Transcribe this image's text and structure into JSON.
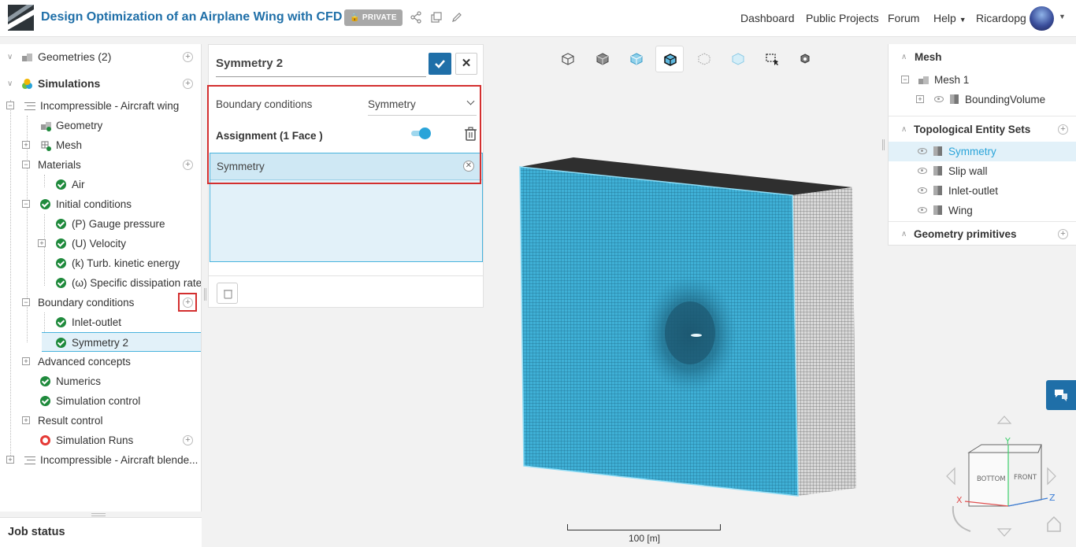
{
  "header": {
    "project_title": "Design Optimization of an Airplane Wing with CFD",
    "private_badge": "PRIVATE",
    "nav": [
      "Dashboard",
      "Public Projects",
      "Forum",
      "Help",
      "Ricardopg"
    ]
  },
  "tree": {
    "geometries": "Geometries (2)",
    "simulations": "Simulations",
    "sim1": "Incompressible - Aircraft wing",
    "geometry": "Geometry",
    "mesh": "Mesh",
    "materials": "Materials",
    "air": "Air",
    "initial_conditions": "Initial conditions",
    "gauge_pressure": "(P) Gauge pressure",
    "velocity": "(U) Velocity",
    "tke": "(k) Turb. kinetic energy",
    "sdr": "(ω) Specific dissipation rate",
    "boundary_conditions": "Boundary conditions",
    "inlet_outlet": "Inlet-outlet",
    "symmetry2": "Symmetry 2",
    "advanced_concepts": "Advanced concepts",
    "numerics": "Numerics",
    "simulation_control": "Simulation control",
    "result_control": "Result control",
    "simulation_runs": "Simulation Runs",
    "sim2": "Incompressible - Aircraft blende..."
  },
  "job_status": "Job status",
  "dialog": {
    "title": "Symmetry 2",
    "bc_label": "Boundary conditions",
    "bc_value": "Symmetry",
    "assignment_label": "Assignment (1 Face )",
    "assigned_face": "Symmetry"
  },
  "right_panel": {
    "mesh_header": "Mesh",
    "mesh1": "Mesh 1",
    "bounding_volume": "BoundingVolume",
    "tes_header": "Topological Entity Sets",
    "entity_sets": [
      "Symmetry",
      "Slip wall",
      "Inlet-outlet",
      "Wing"
    ],
    "geometry_primitives": "Geometry primitives"
  },
  "viewer": {
    "scale_label": "100 [m]",
    "cube_bottom": "BOTTOM",
    "cube_front": "FRONT",
    "axis_x": "X",
    "axis_y": "Y",
    "axis_z": "Z"
  },
  "colors": {
    "brand_blue": "#1f6fa8",
    "mesh_face": "#3fb0d6",
    "selection": "#e2f1f9",
    "check_green": "#1f8a3c",
    "highlight_red": "#d32f2f"
  }
}
